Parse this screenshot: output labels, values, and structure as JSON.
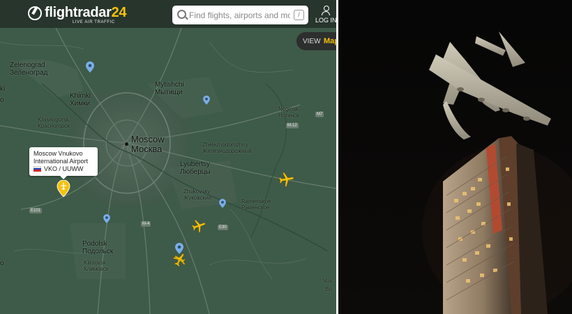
{
  "header": {
    "logo_prefix": "flightradar",
    "logo_number": "24",
    "logo_tagline": "LIVE AIR TRAFFIC",
    "search_placeholder": "Find flights, airports and more",
    "search_shortcut": "/",
    "login_label": "LOG IN",
    "view_label": "VIEW",
    "view_mode": "Map"
  },
  "map": {
    "places": [
      {
        "en": "Zelenograd",
        "ru": "Зеленоград"
      },
      {
        "en": "Mytishchi",
        "ru": "Мытищи"
      },
      {
        "en": "Khimki",
        "ru": "Химки"
      },
      {
        "en": "Krasnogorsk",
        "ru": "Красногорск"
      },
      {
        "en": "Noginsk",
        "ru": "Ногинск"
      },
      {
        "en": "Moscow",
        "ru": "Москва"
      },
      {
        "en": "Zheleznodorozhny",
        "ru": "Железнодорожный"
      },
      {
        "en": "Lyubertsy",
        "ru": "Люберцы"
      },
      {
        "en": "Zhukovsky",
        "ru": "Жуковский"
      },
      {
        "en": "Ramenskoe",
        "ru": "Раменское"
      },
      {
        "en": "Podolsk",
        "ru": "Подольск"
      },
      {
        "en": "Klimovsk",
        "ru": "Климовск"
      }
    ],
    "edge_fragments": [
      "ki",
      "o",
      "Vos",
      "Bo",
      "o"
    ],
    "road_badges": [
      "M-12",
      "M7",
      "E101",
      "M-4",
      "E30"
    ],
    "airport_card": {
      "line1": "Moscow Vnukovo",
      "line2": "International Airport",
      "codes": "VKO / UUWW"
    },
    "airport_pin_color": "#f4c20d",
    "other_pin_color": "#7aaee8",
    "aircraft_color": "#f4c20d",
    "aircraft_count": 4
  },
  "colors": {
    "map_background": "#3f5a49",
    "header_overlay": "#1a1e1c",
    "brand_yellow": "#f4c20d"
  }
}
